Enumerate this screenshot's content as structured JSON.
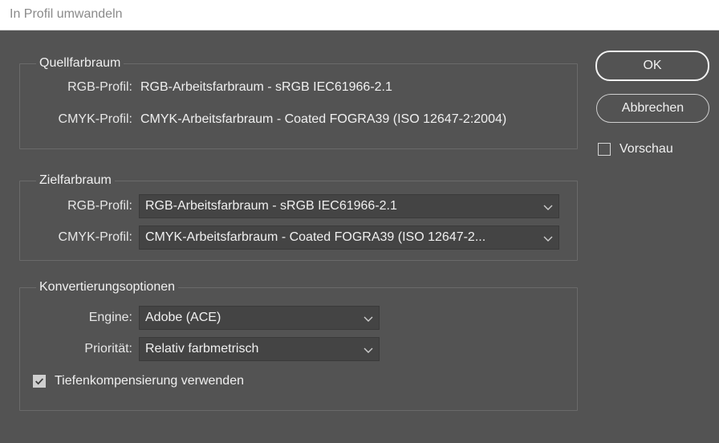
{
  "window": {
    "title": "In Profil umwandeln"
  },
  "source": {
    "legend": "Quellfarbraum",
    "rgb_label": "RGB-Profil:",
    "rgb_value": "RGB-Arbeitsfarbraum - sRGB IEC61966-2.1",
    "cmyk_label": "CMYK-Profil:",
    "cmyk_value": "CMYK-Arbeitsfarbraum - Coated FOGRA39 (ISO 12647-2:2004)"
  },
  "target": {
    "legend": "Zielfarbraum",
    "rgb_label": "RGB-Profil:",
    "rgb_selected": "RGB-Arbeitsfarbraum - sRGB IEC61966-2.1",
    "cmyk_label": "CMYK-Profil:",
    "cmyk_selected": "CMYK-Arbeitsfarbraum - Coated FOGRA39 (ISO 12647-2..."
  },
  "conversion": {
    "legend": "Konvertierungsoptionen",
    "engine_label": "Engine:",
    "engine_selected": "Adobe (ACE)",
    "priority_label": "Priorität:",
    "priority_selected": "Relativ farbmetrisch",
    "blackpoint_label": "Tiefenkompensierung verwenden",
    "blackpoint_checked": true
  },
  "buttons": {
    "ok": "OK",
    "cancel": "Abbrechen"
  },
  "preview": {
    "label": "Vorschau",
    "checked": false
  },
  "colors": {
    "background": "#535353",
    "field": "#444444",
    "border": "#6a6a6a",
    "text": "#f0f0f0"
  }
}
